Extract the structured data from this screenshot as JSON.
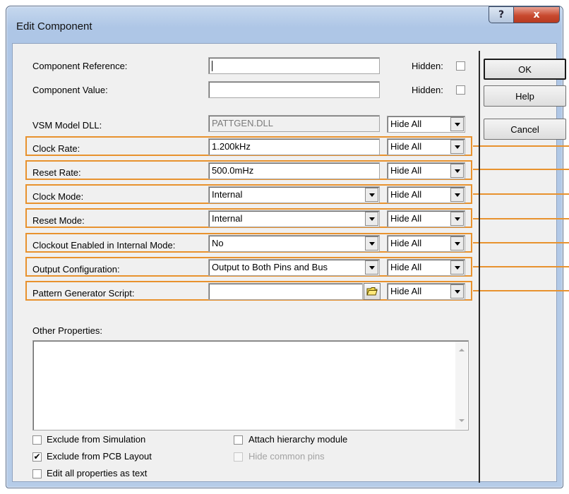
{
  "window": {
    "title": "Edit Component",
    "help_glyph": "?",
    "close_glyph": "x"
  },
  "fields": [
    {
      "label": "Component Reference:",
      "value": "",
      "hidden_label": "Hidden:",
      "hidden_checked": false
    },
    {
      "label": "Component Value:",
      "value": "",
      "hidden_label": "Hidden:",
      "hidden_checked": false
    }
  ],
  "vsm": {
    "label": "VSM Model DLL:",
    "value": "PATTGEN.DLL",
    "hide": "Hide All"
  },
  "properties": [
    {
      "label": "Clock Rate:",
      "kind": "text",
      "value": "1.200kHz",
      "hide": "Hide All"
    },
    {
      "label": "Reset Rate:",
      "kind": "text",
      "value": "500.0mHz",
      "hide": "Hide All"
    },
    {
      "label": "Clock Mode:",
      "kind": "combo",
      "value": "Internal",
      "hide": "Hide All"
    },
    {
      "label": "Reset Mode:",
      "kind": "combo",
      "value": "Internal",
      "hide": "Hide All"
    },
    {
      "label": "Clockout Enabled in Internal Mode:",
      "kind": "combo",
      "value": "No",
      "hide": "Hide All"
    },
    {
      "label": "Output Configuration:",
      "kind": "combo",
      "value": "Output to Both Pins and Bus",
      "hide": "Hide All"
    },
    {
      "label": "Pattern Generator Script:",
      "kind": "file",
      "value": "",
      "hide": "Hide All"
    }
  ],
  "other": {
    "label": "Other Properties:",
    "value": ""
  },
  "checkboxes": [
    {
      "label": "Exclude from Simulation",
      "checked": false,
      "enabled": true
    },
    {
      "label": "Exclude from PCB Layout",
      "checked": true,
      "enabled": true
    },
    {
      "label": "Edit all properties as text",
      "checked": false,
      "enabled": true
    },
    {
      "label": "Attach hierarchy module",
      "checked": false,
      "enabled": true
    },
    {
      "label": "Hide common pins",
      "checked": false,
      "enabled": false
    }
  ],
  "buttons": {
    "ok": "OK",
    "help": "Help",
    "cancel": "Cancel"
  },
  "check_glyph": "✔",
  "colors": {
    "highlight": "#e8922e",
    "title_bg": "#c6d8ee",
    "close": "#c8492f"
  },
  "icons": {
    "folder": "folder-icon",
    "dropdown": "chevron-down-icon"
  }
}
